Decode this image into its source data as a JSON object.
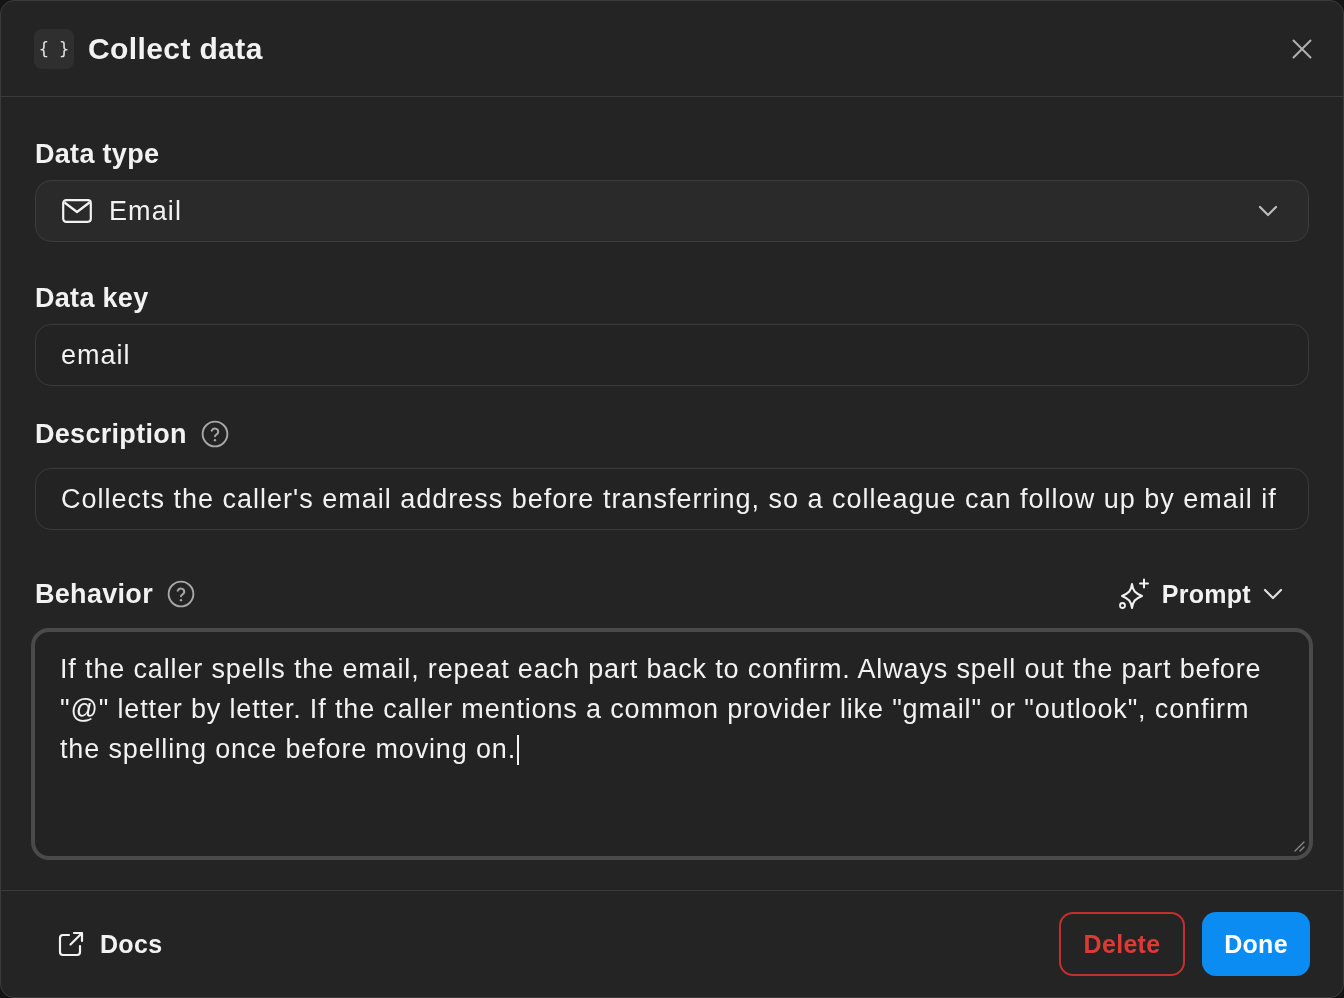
{
  "dialog": {
    "icon_glyph": "{ }",
    "title": "Collect data"
  },
  "fields": [
    {
      "kind": "select",
      "label": "Data type",
      "help": false,
      "value": "Email"
    },
    {
      "kind": "input",
      "label": "Data key",
      "help": false,
      "value": "email"
    },
    {
      "kind": "input",
      "label": "Description",
      "help": true,
      "value": "Collects the caller's email address before transferring, so a colleague can follow up by email if"
    },
    {
      "kind": "textarea",
      "label": "Behavior",
      "help": true,
      "mode": "Prompt",
      "focused": true,
      "value": "If the caller spells the email, repeat each part back to confirm. Always spell out the part before \"@\" letter by letter. If the caller mentions a common provider like \"gmail\" or \"outlook\", confirm the spelling once before moving on."
    }
  ],
  "footer": {
    "link": "Docs",
    "buttons": [
      {
        "kind": "danger",
        "label": "Delete"
      },
      {
        "kind": "primary",
        "label": "Done"
      }
    ]
  }
}
